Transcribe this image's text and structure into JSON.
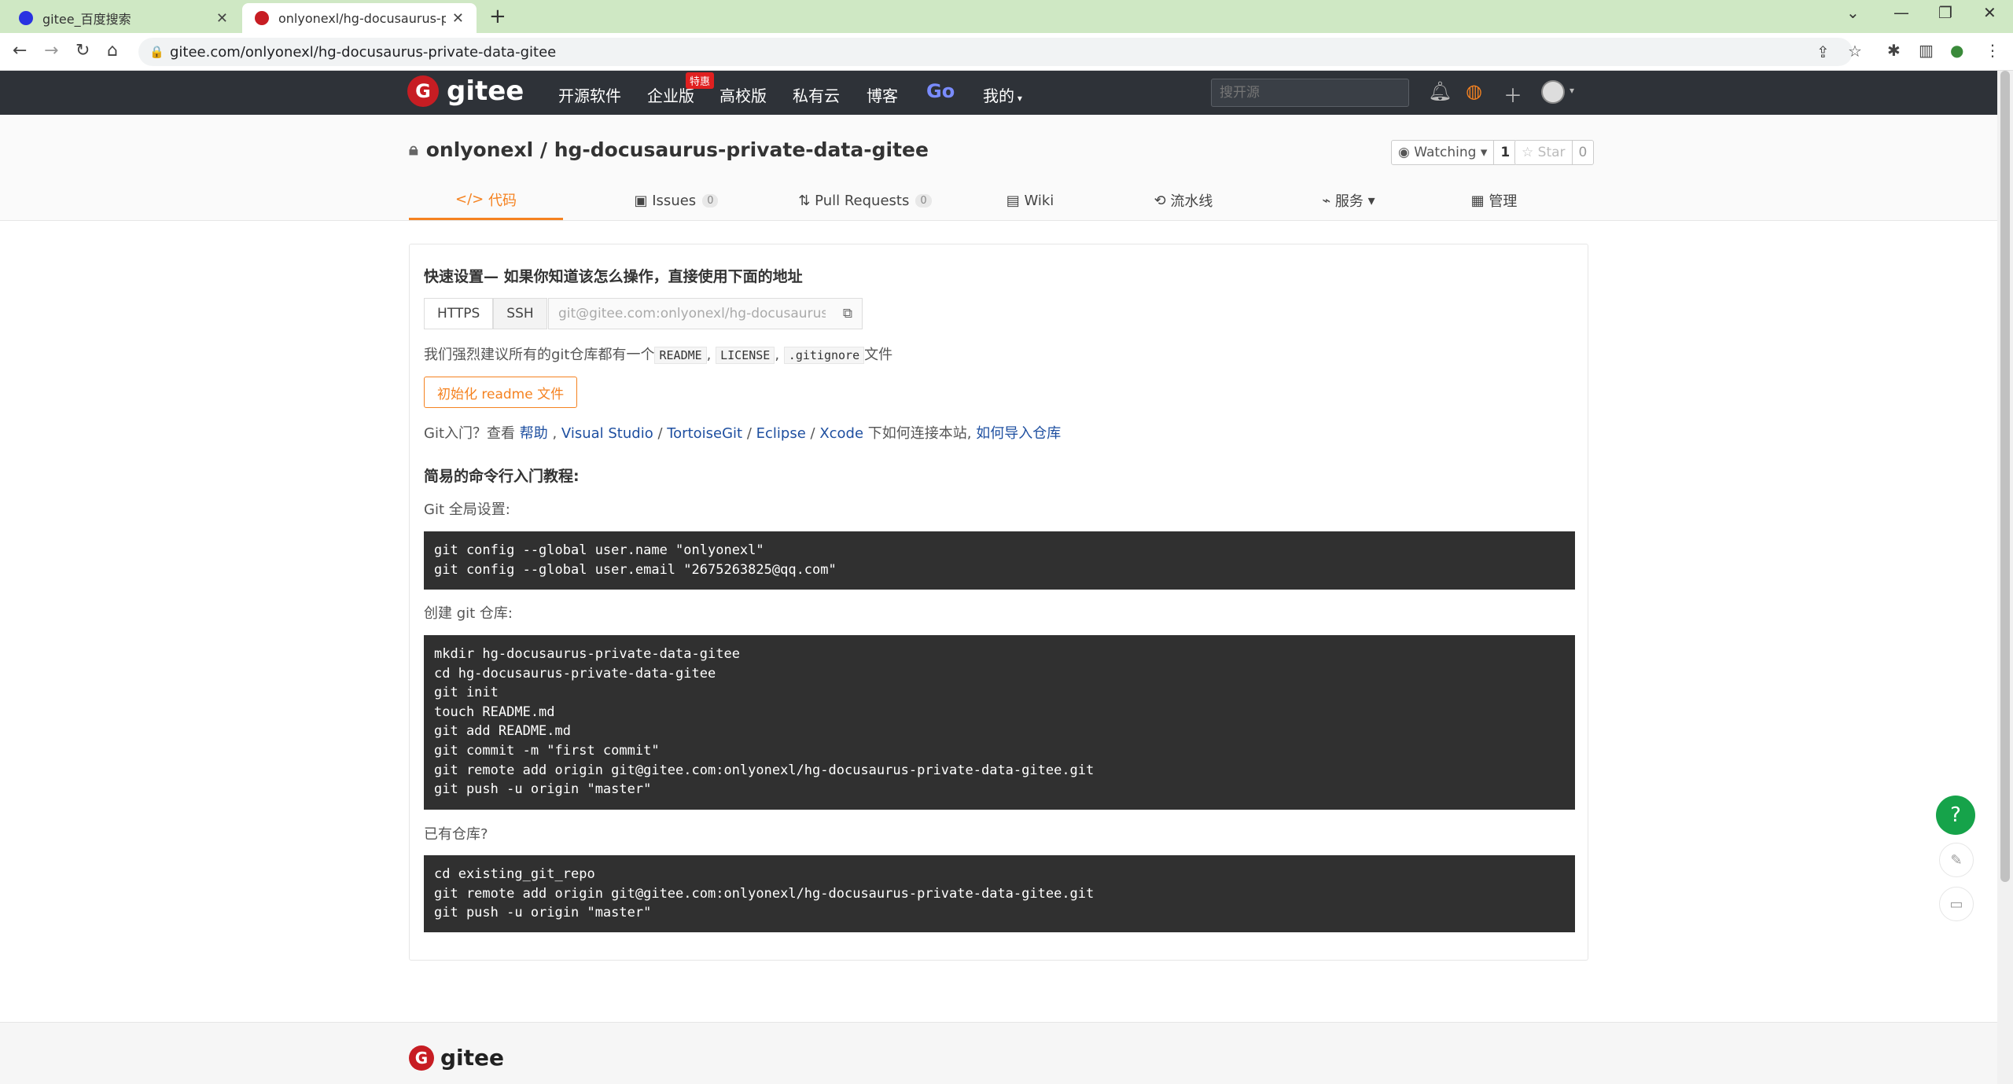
{
  "browser": {
    "tabs": [
      {
        "label": "gitee_百度搜索",
        "icon": "baidu-icon"
      },
      {
        "label": "onlyonexl/hg-docusaurus-private-data-gitee",
        "icon": "gitee-icon"
      }
    ],
    "url": "gitee.com/onlyonexl/hg-docusaurus-private-data-gitee"
  },
  "header": {
    "logo_text": "gitee",
    "nav": [
      "开源软件",
      "企业版",
      "高校版",
      "私有云",
      "博客",
      "Go",
      "我的"
    ],
    "enterprise_badge": "特惠",
    "search_placeholder": "搜开源"
  },
  "repo": {
    "title": "onlyonexl / hg-docusaurus-private-data-gitee",
    "watching_label": "Watching",
    "watching_count": "1",
    "star_label": "Star",
    "star_count": "0",
    "tabs": [
      {
        "label": "代码",
        "count": null,
        "active": true
      },
      {
        "label": "Issues",
        "count": "0"
      },
      {
        "label": "Pull Requests",
        "count": "0"
      },
      {
        "label": "Wiki",
        "count": null
      },
      {
        "label": "流水线",
        "count": null
      },
      {
        "label": "服务",
        "count": null
      },
      {
        "label": "管理",
        "count": null
      }
    ]
  },
  "quick_setup": {
    "heading": "快速设置— 如果你知道该怎么操作，直接使用下面的地址",
    "protocols": [
      "HTTPS",
      "SSH"
    ],
    "clone_url": "git@gitee.com:onlyonexl/hg-docusaurus-private-data-gitee.git",
    "recommend_prefix": "我们强烈建议所有的git仓库都有一个",
    "recommend_files": [
      "README",
      "LICENSE",
      ".gitignore"
    ],
    "recommend_suffix": "文件",
    "init_button": "初始化 readme 文件",
    "help_prefix": "Git入门？查看",
    "help_links": [
      "帮助",
      "Visual Studio",
      "TortoiseGit",
      "Eclipse",
      "Xcode"
    ],
    "help_middle": "下如何连接本站,",
    "help_import": "如何导入仓库"
  },
  "tutorial": {
    "heading": "简易的命令行入门教程:",
    "global_label": "Git 全局设置:",
    "global_code": "git config --global user.name \"onlyonexl\"\ngit config --global user.email \"2675263825@qq.com\"",
    "create_label": "创建 git 仓库:",
    "create_code": "mkdir hg-docusaurus-private-data-gitee\ncd hg-docusaurus-private-data-gitee\ngit init\ntouch README.md\ngit add README.md\ngit commit -m \"first commit\"\ngit remote add origin git@gitee.com:onlyonexl/hg-docusaurus-private-data-gitee.git\ngit push -u origin \"master\"",
    "existing_label": "已有仓库?",
    "existing_code": "cd existing_git_repo\ngit remote add origin git@gitee.com:onlyonexl/hg-docusaurus-private-data-gitee.git\ngit push -u origin \"master\""
  },
  "floating": {
    "help": "?"
  },
  "footer": {
    "logo_text": "gitee"
  },
  "colors": {
    "brand": "#c71d23",
    "accent": "#f58220",
    "header_bg": "#2e3238",
    "link": "#1e4fa0",
    "code_bg": "#303030"
  }
}
